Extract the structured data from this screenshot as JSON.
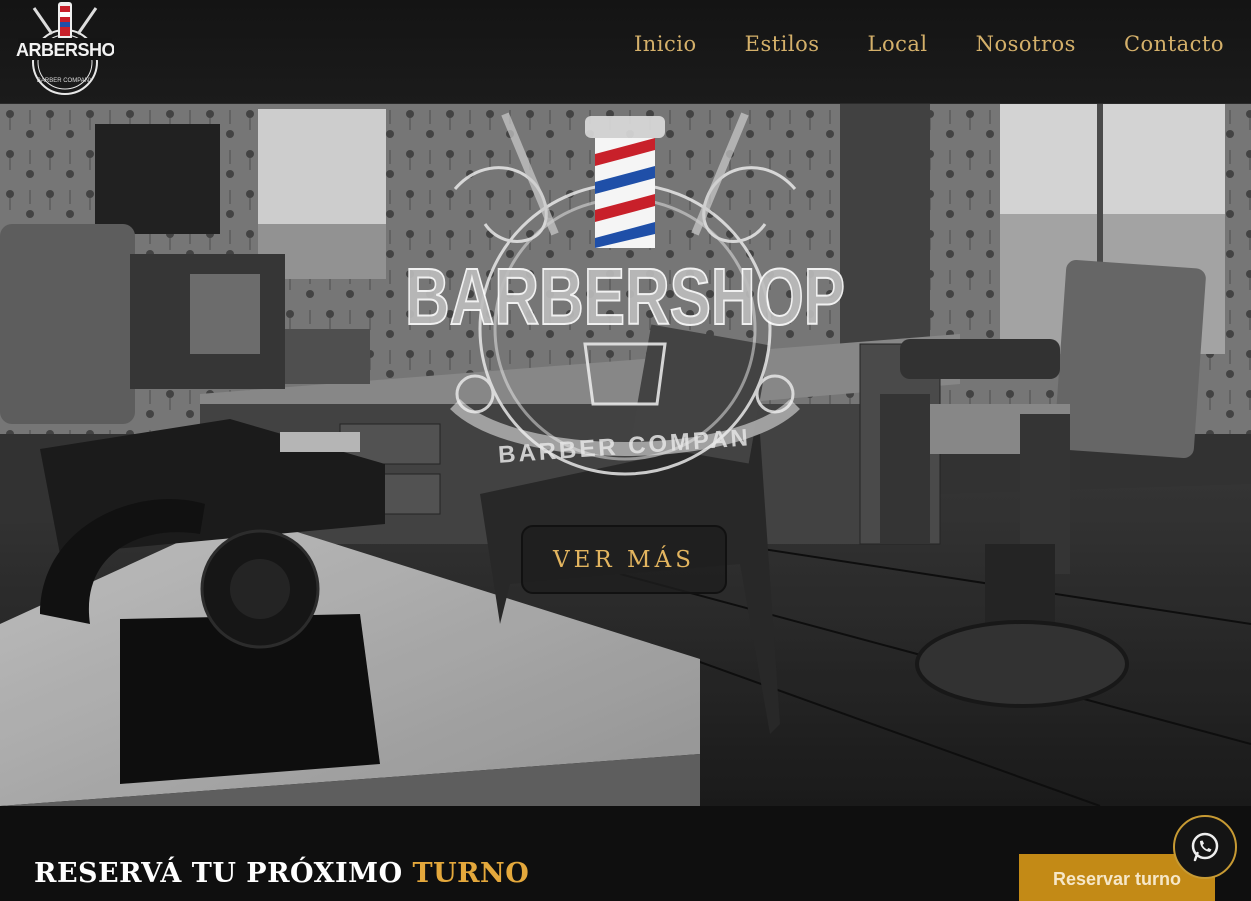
{
  "brand": {
    "logo_text": "BARBERSHOP",
    "logo_subtext": "BARBER COMPANY",
    "logo_icon": "barber-pole-logo"
  },
  "nav": {
    "items": [
      "Inicio",
      "Estilos",
      "Local",
      "Nosotros",
      "Contacto"
    ]
  },
  "hero": {
    "overlay_title": "BARBERSHOP",
    "overlay_subtitle": "BARBER COMPAN",
    "button_label": "VER MÁS"
  },
  "reserve": {
    "title_main": "RESERVÁ TU PRÓXIMO ",
    "title_accent": "TURNO",
    "button_label": "Reservar turno"
  },
  "whatsapp": {
    "icon": "whatsapp-icon"
  },
  "colors": {
    "gold": "#d4b06a",
    "accent_orange": "#e4a83c",
    "button_bg": "#c38a16",
    "dark_bg": "#0f0f0f"
  }
}
